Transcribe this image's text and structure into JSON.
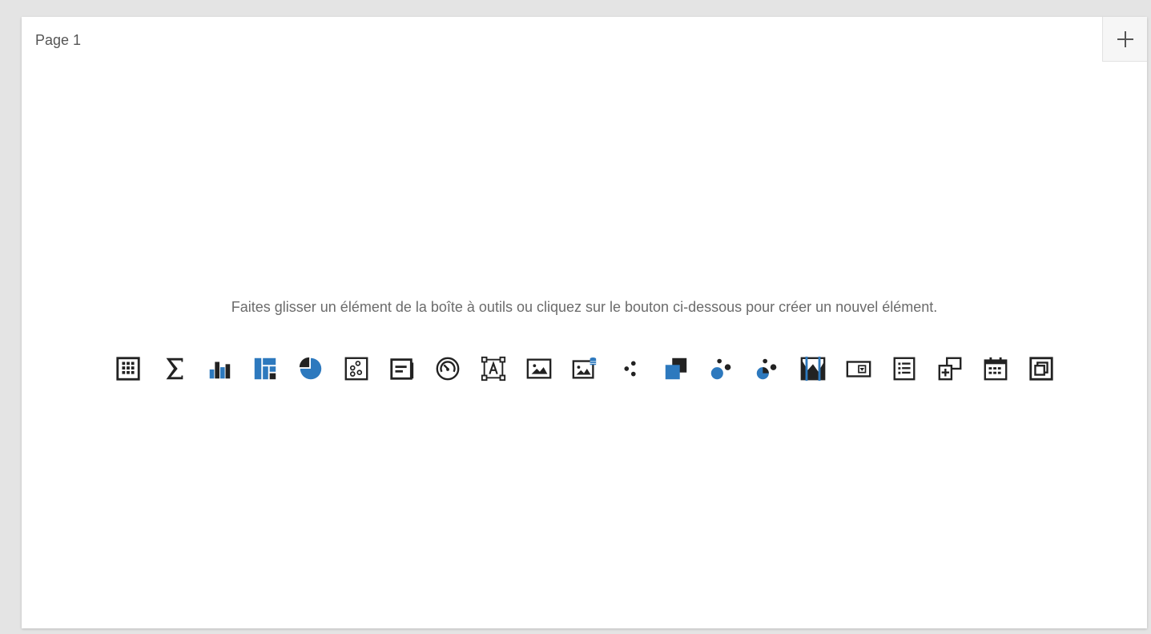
{
  "page": {
    "tab_label": "Page 1",
    "add_button_symbol": "+",
    "hint": "Faites glisser un élément de la boîte à outils ou cliquez sur le bouton ci-dessous pour créer un nouvel élément."
  },
  "colors": {
    "dark": "#222222",
    "accent": "#2d79be",
    "hint_text": "#6b6b6b",
    "tab_text": "#555555"
  },
  "tools": [
    {
      "icon": "grid-icon"
    },
    {
      "icon": "sigma-icon"
    },
    {
      "icon": "bar-chart-icon"
    },
    {
      "icon": "treemap-icon"
    },
    {
      "icon": "pie-chart-icon"
    },
    {
      "icon": "scatter-card-icon"
    },
    {
      "icon": "card-icon"
    },
    {
      "icon": "gauge-icon"
    },
    {
      "icon": "text-box-icon"
    },
    {
      "icon": "image-icon"
    },
    {
      "icon": "bound-image-icon"
    },
    {
      "icon": "dots-icon"
    },
    {
      "icon": "group-icon"
    },
    {
      "icon": "bubble-map-icon"
    },
    {
      "icon": "pie-map-icon"
    },
    {
      "icon": "range-filter-icon"
    },
    {
      "icon": "combo-box-icon"
    },
    {
      "icon": "list-box-icon"
    },
    {
      "icon": "tree-view-icon"
    },
    {
      "icon": "date-filter-icon"
    },
    {
      "icon": "tab-container-icon"
    }
  ]
}
